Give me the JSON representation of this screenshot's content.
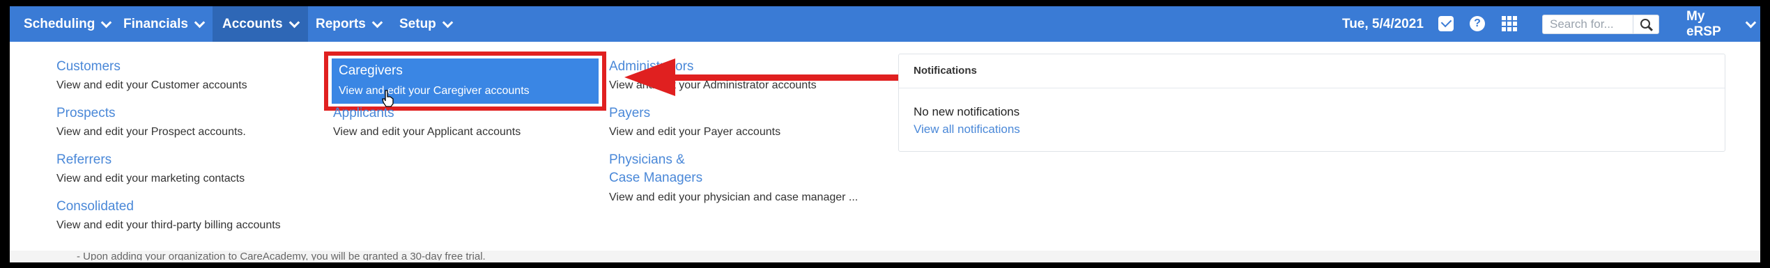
{
  "nav": {
    "items": [
      {
        "label": "Scheduling",
        "active": false
      },
      {
        "label": "Financials",
        "active": false
      },
      {
        "label": "Accounts",
        "active": true
      },
      {
        "label": "Reports",
        "active": false
      },
      {
        "label": "Setup",
        "active": false
      }
    ],
    "date": "Tue, 5/4/2021",
    "search_placeholder": "Search for...",
    "user_menu": "My eRSP",
    "icons": [
      "mail-icon",
      "help-icon",
      "apps-grid-icon",
      "search-icon"
    ],
    "colors": {
      "bar": "#3a7bd5",
      "active": "#2e67b6",
      "link": "#4a88d8",
      "highlight": "#3a86e4",
      "annotation": "#e02020"
    }
  },
  "dropdown": {
    "col1": [
      {
        "title": "Customers",
        "desc": "View and edit your Customer accounts"
      },
      {
        "title": "Prospects",
        "desc": "View and edit your Prospect accounts."
      },
      {
        "title": "Referrers",
        "desc": "View and edit your marketing contacts"
      },
      {
        "title": "Consolidated",
        "desc": "View and edit your third-party billing accounts"
      }
    ],
    "col2": [
      {
        "title": "Caregivers",
        "desc": "View and edit your Caregiver accounts"
      },
      {
        "title": "Applicants",
        "desc": "View and edit your Applicant accounts"
      }
    ],
    "col3": [
      {
        "title": "Administrators",
        "desc": "View and edit your Administrator accounts"
      },
      {
        "title": "Payers",
        "desc": "View and edit your Payer accounts"
      },
      {
        "title_line1": "Physicians &",
        "title_line2": "Case Managers",
        "desc": "View and edit your physician and case manager ..."
      }
    ]
  },
  "notifications": {
    "title": "Notifications",
    "empty": "No new notifications",
    "link": "View all notifications"
  },
  "background": {
    "text": "- Upon adding your organization to CareAcademy, you will be granted a 30-day free trial."
  }
}
